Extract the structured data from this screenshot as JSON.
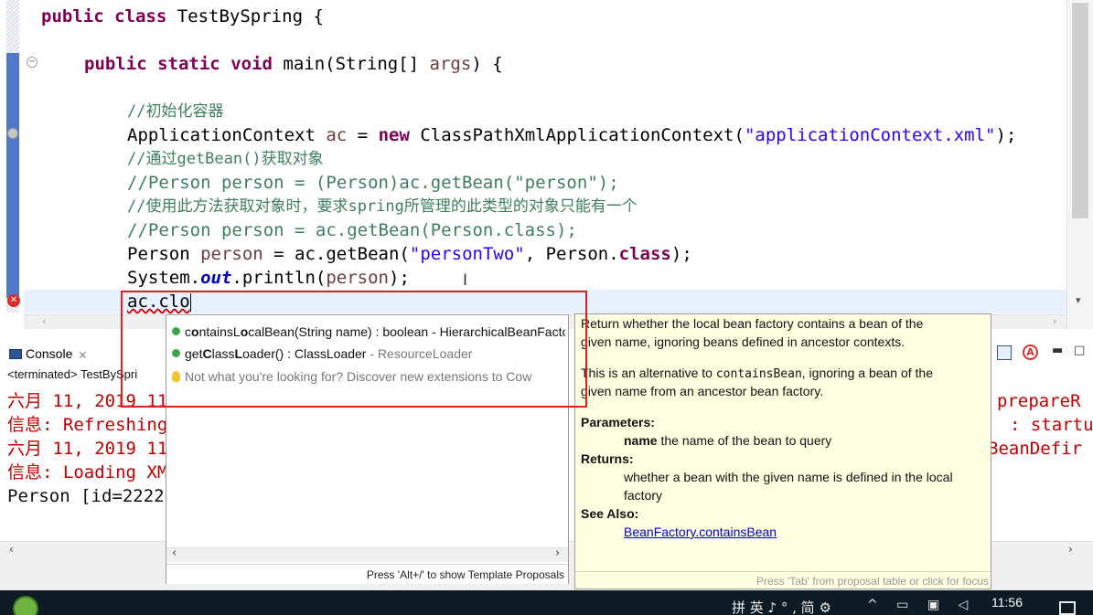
{
  "editor": {
    "line1": {
      "kw1": "public",
      "kw2": "class",
      "rest": " TestBySpring {"
    },
    "line2": {
      "kw1": "public",
      "kw2": "static",
      "kw3": "void",
      "rest": " main(String[] ",
      "param": "args",
      "end": ") {"
    },
    "c_init": "//初始化容器",
    "line_ac": {
      "type": "ApplicationContext ",
      "var": "ac",
      "eq": " = ",
      "kw": "new",
      "ctor": " ClassPathXmlApplicationContext(",
      "str": "\"applicationContext.xml\"",
      "end": ");"
    },
    "c_getbean": "//通过getBean()获取对象",
    "c_person1": "//Person person = (Person)ac.getBean(\"person\");",
    "c_note": "//使用此方法获取对象时，要求spring所管理的此类型的对象只能有一个",
    "c_person2": "//Person person = ac.getBean(Person.class);",
    "line_person": {
      "type": "Person ",
      "var": "person",
      "mid": " = ac.getBean(",
      "str": "\"personTwo\"",
      "mid2": ", Person.",
      "kw": "class",
      "end": ");"
    },
    "line_print": {
      "pre": "System.",
      "field": "out",
      "mid": ".println(",
      "var": "person",
      "end": ");"
    },
    "line_current": "ac.clo"
  },
  "console": {
    "tab_label": "Console",
    "terminated": "<terminated> TestBySpri",
    "lines": [
      {
        "left": "六月 11, 2019 11",
        "right": "prepareR"
      },
      {
        "left": "信息: Refreshing",
        "right": ": startup"
      },
      {
        "left": "六月 11, 2019 11",
        "right": "BeanDefir"
      },
      {
        "left": "信息: Loading XM",
        "right": ""
      },
      {
        "left": "Person [id=2222",
        "right": ""
      }
    ]
  },
  "proposals": {
    "items": [
      {
        "pre": "c",
        "b1": "o",
        "mid": "ntainsL",
        "b2": "o",
        "rest": "calBean(String name) : boolean - HierarchicalBeanFactory",
        "icon": "public-method-icon"
      },
      {
        "pre": "get",
        "b1": "C",
        "mid": "lass",
        "b2": "L",
        "rest": "oader() : ClassLoader",
        "sep": " - ",
        "src": "ResourceLoader",
        "icon": "public-method-icon"
      },
      {
        "text": "Not what you're looking for? Discover new extensions to Cow",
        "icon": "lightbulb-icon"
      }
    ],
    "footer": "Press 'Alt+/' to show Template Proposals"
  },
  "javadoc": {
    "p1a": "Return whether the local bean factory contains a bean of the",
    "p1b": "given name, ignoring beans defined in ancestor contexts.",
    "p2a_pre": "This is an alternative to ",
    "p2a_code": "containsBean",
    "p2a_post": ", ignoring a bean of the",
    "p2b": "given name from an ancestor bean factory.",
    "params_h": "Parameters:",
    "param_name": "name",
    "param_desc": " the name of the bean to query",
    "returns_h": "Returns:",
    "returns_a": "whether a bean with the given name is defined in the local",
    "returns_b": "factory",
    "see_h": "See Also:",
    "see_link": "BeanFactory.containsBean",
    "footer": "Press 'Tab' from proposal table or click for focus"
  },
  "taskbar": {
    "time": "11:56",
    "ime": "拼 英 ♪ ° , 简 ⚙"
  },
  "colors": {
    "keyword": "#7f0055",
    "string": "#2a00ff",
    "comment": "#3f7f5f",
    "error": "#c00000",
    "highlight": "#e02020"
  }
}
